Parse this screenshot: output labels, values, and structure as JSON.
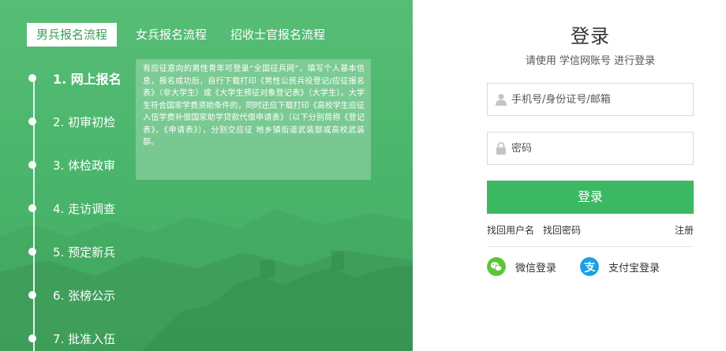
{
  "tabs": [
    {
      "label": "男兵报名流程",
      "active": true
    },
    {
      "label": "女兵报名流程",
      "active": false
    },
    {
      "label": "招收士官报名流程",
      "active": false
    }
  ],
  "steps": [
    {
      "label": "1. 网上报名",
      "active": true
    },
    {
      "label": "2. 初审初检",
      "active": false
    },
    {
      "label": "3. 体检政审",
      "active": false
    },
    {
      "label": "4. 走访调查",
      "active": false
    },
    {
      "label": "5. 预定新兵",
      "active": false
    },
    {
      "label": "6. 张榜公示",
      "active": false
    },
    {
      "label": "7. 批准入伍",
      "active": false
    }
  ],
  "info": {
    "text": "有应征意向的男性青年可登录“全国征兵网”，填写个人基本信息，报名成功后，自行下载打印《男性公民兵役登记/应征报名表》（非大学生）或《大学生预征对象登记表》（大学生）。大学生符合国家学费资助条件的，同时还应下载打印《高校学生应征入伍学费补偿国家助学贷款代偿申请表》（以下分别简称《登记表》、《申请表》），分别交应征 地乡镇街道武装部或高校武装部。"
  },
  "login": {
    "title": "登录",
    "subtitle": "请使用 学信网账号 进行登录",
    "username_placeholder": "手机号/身份证号/邮箱",
    "password_placeholder": "密码",
    "button": "登录",
    "find_username": "找回用户名",
    "find_password": "找回密码",
    "register": "注册",
    "wechat": "微信登录",
    "alipay": "支付宝登录"
  },
  "colors": {
    "panel_green": "#4cb46c",
    "button_green": "#3cb863",
    "wechat_green": "#5cc43a",
    "alipay_blue": "#1aa0e3"
  }
}
